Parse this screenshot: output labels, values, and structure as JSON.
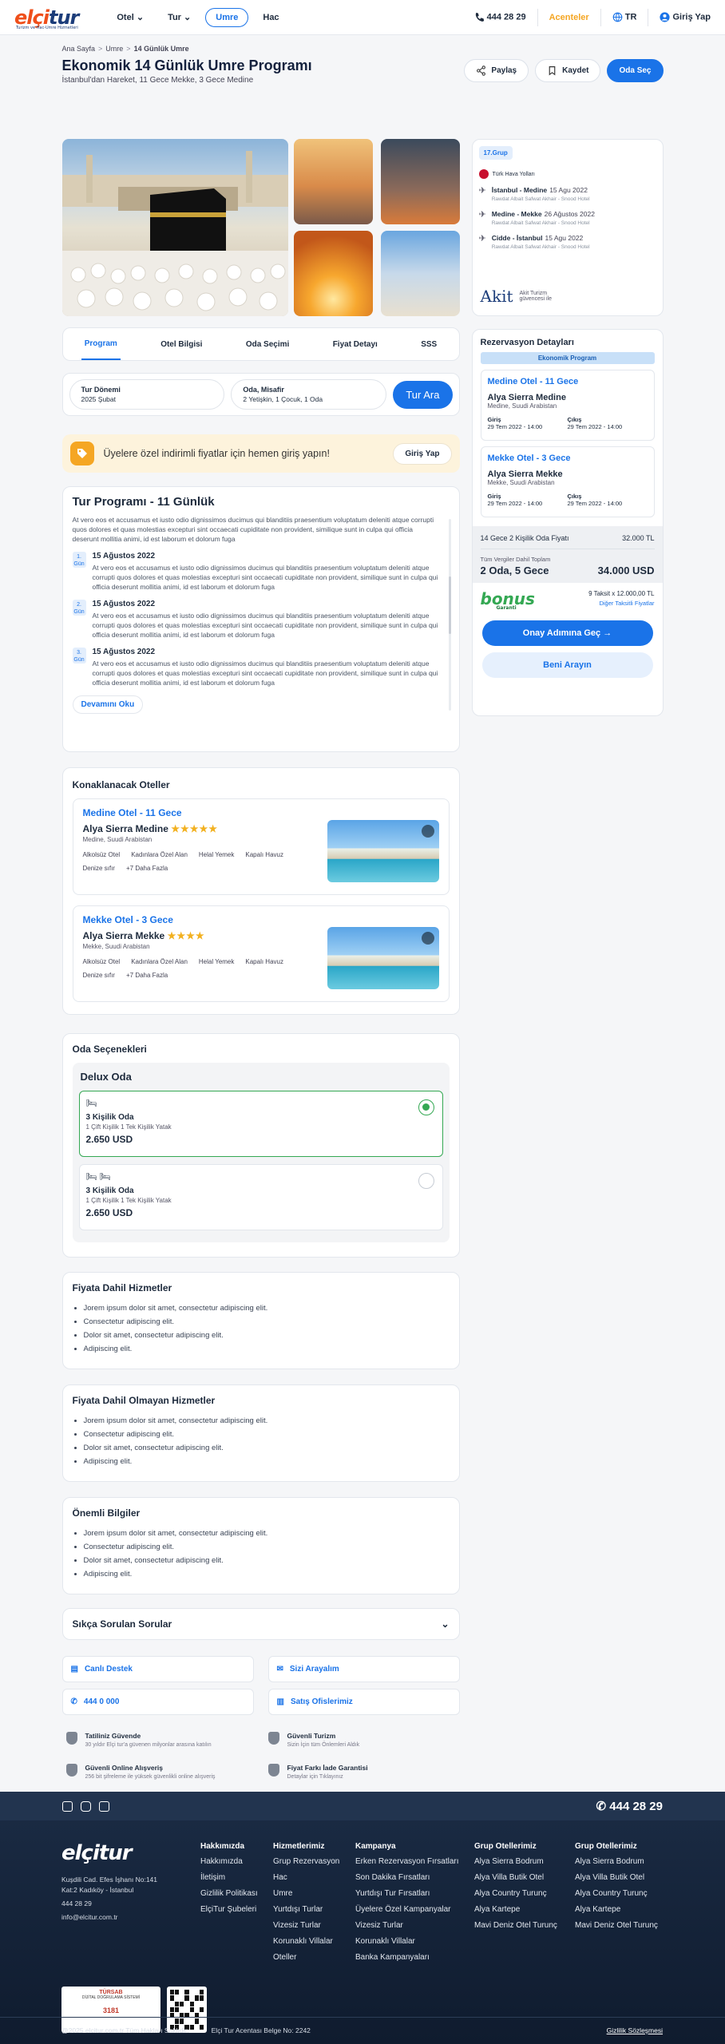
{
  "header": {
    "logo": "elçitur",
    "logo_sub": "Turizm ve Hac-Umre Hizmetleri",
    "nav": [
      {
        "label": "Otel"
      },
      {
        "label": "Tur"
      },
      {
        "label": "Umre"
      },
      {
        "label": "Hac"
      }
    ],
    "phone": "444 28 29",
    "agencies": "Acenteler",
    "lang": "TR",
    "login": "Giriş Yap"
  },
  "breadcrumb": [
    "Ana Sayfa",
    "Umre",
    "14 Günlük Umre"
  ],
  "title": "Ekonomik 14 Günlük Umre Programı",
  "subtitle": "İstanbul'dan Hareket, 11 Gece Mekke, 3 Gece Medine",
  "actions": {
    "share": "Paylaş",
    "save": "Kaydet",
    "room": "Oda Seç"
  },
  "tabs": [
    "Program",
    "Otel Bilgisi",
    "Oda Seçimi",
    "Fiyat Detayı",
    "SSS"
  ],
  "search": {
    "period_label": "Tur Dönemi",
    "period_value": "2025 Şubat",
    "room_label": "Oda, Misafir",
    "room_value": "2 Yetişkin, 1 Çocuk, 1 Oda",
    "button": "Tur Ara"
  },
  "promo": {
    "text": "Üyelere özel indirimli fiyatlar için hemen giriş yapın!",
    "button": "Giriş Yap"
  },
  "program": {
    "title": "Tur Programı - 11 Günlük",
    "intro": "At vero eos et accusamus et iusto odio dignissimos ducimus qui blanditiis praesentium voluptatum deleniti atque corrupti quos dolores et quas molestias excepturi sint occaecati cupiditate non provident, similique sunt in culpa qui officia deserunt mollitia animi, id est laborum et dolorum fuga",
    "days": [
      {
        "num": "1.",
        "unit": "Gün",
        "date": "15 Ağustos 2022",
        "text": "At vero eos et accusamus et iusto odio dignissimos ducimus qui blanditiis praesentium voluptatum deleniti atque corrupti quos dolores et quas molestias excepturi sint occaecati cupiditate non provident, similique sunt in culpa qui officia deserunt mollitia animi, id est laborum et dolorum fuga"
      },
      {
        "num": "2.",
        "unit": "Gün",
        "date": "15 Ağustos 2022",
        "text": "At vero eos et accusamus et iusto odio dignissimos ducimus qui blanditiis praesentium voluptatum deleniti atque corrupti quos dolores et quas molestias excepturi sint occaecati cupiditate non provident, similique sunt in culpa qui officia deserunt mollitia animi, id est laborum et dolorum fuga"
      },
      {
        "num": "3.",
        "unit": "Gün",
        "date": "15 Ağustos 2022",
        "text": "At vero eos et accusamus et iusto odio dignissimos ducimus qui blanditiis praesentium voluptatum deleniti atque corrupti quos dolores et quas molestias excepturi sint occaecati cupiditate non provident, similique sunt in culpa qui officia deserunt mollitia animi, id est laborum et dolorum fuga"
      }
    ],
    "more": "Devamını Oku"
  },
  "hotels": {
    "title": "Konaklanacak Oteller",
    "items": [
      {
        "city": "Medine Otel - 11 Gece",
        "name": "Alya Sierra Medine",
        "stars": "★★★★★",
        "location": "Medine, Suudi Arabistan",
        "amenities": [
          "Alkolsüz Otel",
          "Kadınlara Özel Alan",
          "Helal Yemek",
          "Kapalı Havuz",
          "Denize sıfır",
          "+7 Daha Fazla"
        ]
      },
      {
        "city": "Mekke Otel - 3 Gece",
        "name": "Alya Sierra Mekke",
        "stars": "★★★★",
        "location": "Mekke, Suudi Arabistan",
        "amenities": [
          "Alkolsüz Otel",
          "Kadınlara Özel Alan",
          "Helal Yemek",
          "Kapalı Havuz",
          "Denize sıfır",
          "+7 Daha Fazla"
        ]
      }
    ]
  },
  "rooms": {
    "title": "Oda Seçenekleri",
    "type": "Delux Oda",
    "options": [
      {
        "name": "3 Kişilik Oda",
        "beds": "1 Çift Kişilik 1 Tek Kişilik Yatak",
        "price": "2.650 USD",
        "selected": true
      },
      {
        "name": "3 Kişilik Oda",
        "beds": "1 Çift Kişilik 1 Tek Kişilik Yatak",
        "price": "2.650 USD",
        "selected": false
      }
    ]
  },
  "lists": [
    {
      "title": "Fiyata Dahil Hizmetler",
      "items": [
        "Jorem ipsum dolor sit amet, consectetur adipiscing elit.",
        "Consectetur adipiscing elit.",
        "Dolor sit amet, consectetur adipiscing elit.",
        "Adipiscing elit."
      ]
    },
    {
      "title": "Fiyata Dahil Olmayan Hizmetler",
      "items": [
        "Jorem ipsum dolor sit amet, consectetur adipiscing elit.",
        "Consectetur adipiscing elit.",
        "Dolor sit amet, consectetur adipiscing elit.",
        "Adipiscing elit."
      ]
    },
    {
      "title": "Önemli Bilgiler",
      "items": [
        "Jorem ipsum dolor sit amet, consectetur adipiscing elit.",
        "Consectetur adipiscing elit.",
        "Dolor sit amet, consectetur adipiscing elit.",
        "Adipiscing elit."
      ]
    }
  ],
  "faq": "Sıkça Sorulan Sorular",
  "contact": [
    "Canlı Destek",
    "Sizi Arayalım",
    "444 0 000",
    "Satış Ofislerimiz"
  ],
  "trust": [
    {
      "title": "Tatiliniz Güvende",
      "text": "30 yıldır Elçi tur'a güvenen milyonlar arasına katılın"
    },
    {
      "title": "Güvenli Turizm",
      "text": "Sizin İçin tüm Önlemleri Aldık"
    },
    {
      "title": "Güvenli Online Alışveriş",
      "text": "256 bit şifreleme ile yüksek güvenlikli online alışveriş"
    },
    {
      "title": "Fiyat Farkı İade Garantisi",
      "text": "Detaylar için Tıklayınız"
    }
  ],
  "ticket": {
    "group": "17.Grup",
    "airline": "Türk Hava Yolları",
    "legs": [
      {
        "route": "İstanbul - Medine",
        "date": "15 Agu 2022",
        "hotel": "Rawdat Albait Safwat Akhair - Snood Hotel"
      },
      {
        "route": "Medine - Mekke",
        "date": "26 Ağustos 2022",
        "hotel": "Rawdat Albait Safwat Akhair - Snood Hotel"
      },
      {
        "route": "Cidde - İstanbul",
        "date": "15 Agu 2022",
        "hotel": "Rawdat Albait Safwat Akhair - Snood Hotel"
      }
    ],
    "akit": "Akit",
    "akit_sub": "Akit Turizm güvencesi ile"
  },
  "reservation": {
    "title": "Rezervasyon Detayları",
    "band": "Ekonomik Program",
    "hotels": [
      {
        "city": "Medine Otel - 11 Gece",
        "name": "Alya Sierra Medine",
        "loc": "Medine, Suudi Arabistan",
        "in_label": "Giriş",
        "in": "29 Tem 2022 - 14:00",
        "out_label": "Çıkış",
        "out": "29 Tem 2022 - 14:00"
      },
      {
        "city": "Mekke Otel - 3 Gece",
        "name": "Alya Sierra Mekke",
        "loc": "Mekke, Suudi Arabistan",
        "in_label": "Giriş",
        "in": "29 Tem 2022 - 14:00",
        "out_label": "Çıkış",
        "out": "29 Tem 2022 - 14:00"
      }
    ],
    "price_label": "14 Gece 2 Kişilik Oda Fiyatı",
    "price": "32.000 TL",
    "tax_label": "Tüm Vergiler Dahil Toplam",
    "total_label": "2 Oda, 5 Gece",
    "total": "34.000 USD",
    "bonus": "bonus",
    "bonus_brand": "Garanti",
    "installment": "9 Taksit x 12.000,00 TL",
    "other": "Diğer Taksitli Fiyatlar",
    "cta": "Onay Adımına Geç",
    "call": "Beni Arayın"
  },
  "footer": {
    "phone": "444 28 29",
    "logo": "elçitur",
    "address": [
      "Kuşdili Cad. Efes İşhanı No:141",
      "Kat:2 Kadıköy - İstanbul",
      "444 28 29",
      "info@elcitur.com.tr"
    ],
    "columns": [
      {
        "title": "Hakkımızda",
        "items": [
          "Hakkımızda",
          "İletişim",
          "Gizlilik Politikası",
          "ElçiTur Şubeleri"
        ]
      },
      {
        "title": "Hizmetlerimiz",
        "items": [
          "Grup Rezervasyon",
          "Hac",
          "Umre",
          "Yurtdışı Turlar",
          "Vizesiz Turlar",
          "Korunaklı Villalar",
          "Oteller"
        ]
      },
      {
        "title": "Kampanya",
        "items": [
          "Erken Rezervasyon Fırsatları",
          "Son Dakika Fırsatları",
          "Yurtdışı Tur Fırsatları",
          "Üyelere Özel Kampanyalar",
          "Vizesiz Turlar",
          "Korunaklı Villalar",
          "Banka Kampanyaları"
        ]
      },
      {
        "title": "Grup Otellerimiz",
        "items": [
          "Alya Sierra Bodrum",
          "Alya Villa Butik Otel",
          "Alya Country Turunç",
          "Alya Kartepe",
          "Mavi Deniz Otel Turunç"
        ]
      },
      {
        "title": "Grup Otellerimiz",
        "items": [
          "Alya Sierra Bodrum",
          "Alya Villa Butik Otel",
          "Alya Country Turunç",
          "Alya Kartepe",
          "Mavi Deniz Otel Turunç"
        ]
      }
    ],
    "tursab": "TÜRSAB",
    "tursab_sub": "DİJİTAL DOĞRULAMA SİSTEMİ",
    "tursab_no": "3181",
    "copyright": "@2025 elcitur.com.tr Tüm Hakları Saklıdır.",
    "license": "Elçi Tur Acentası Belge No: 2242",
    "terms": "Gizlilik Sözleşmesi"
  }
}
